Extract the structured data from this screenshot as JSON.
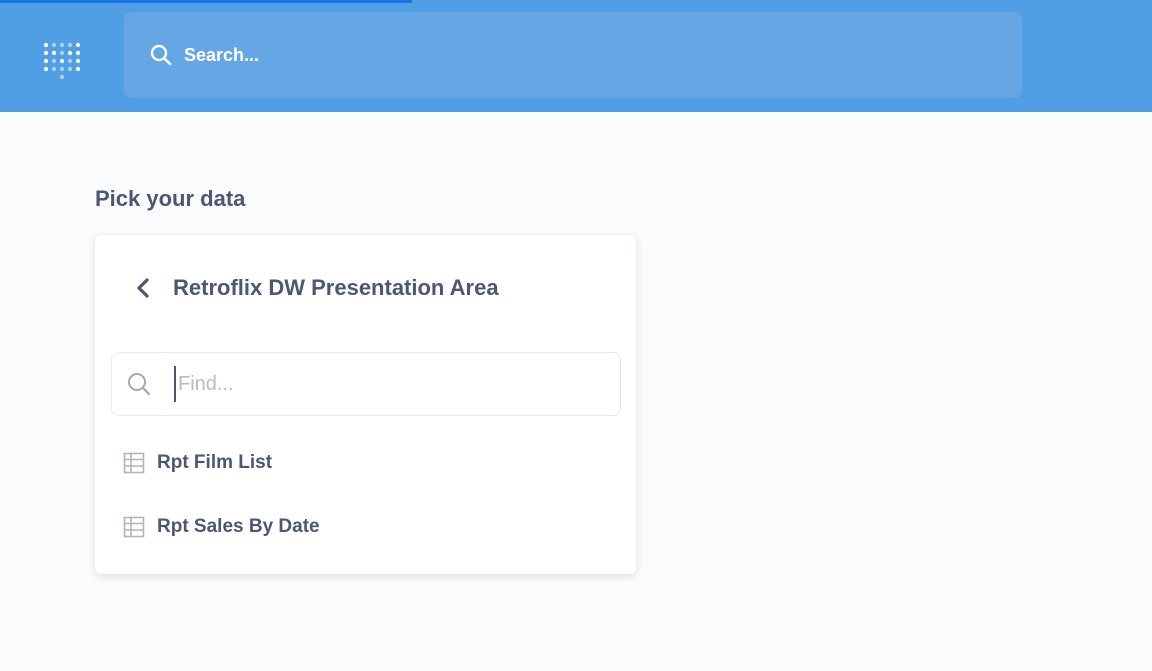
{
  "colors": {
    "topbar": "#509ee3",
    "search_bg": "#65a7e5",
    "text": "#4c5773",
    "placeholder": "#b8bbc3"
  },
  "search": {
    "placeholder": "Search...",
    "icon": "search-icon"
  },
  "picker": {
    "heading": "Pick your data",
    "back_icon": "chevron-left-icon",
    "title": "Retroflix DW Presentation Area",
    "find_placeholder": "Find...",
    "items": [
      {
        "label": "Rpt Film List",
        "icon": "table-icon"
      },
      {
        "label": "Rpt Sales By Date",
        "icon": "table-icon"
      }
    ]
  }
}
